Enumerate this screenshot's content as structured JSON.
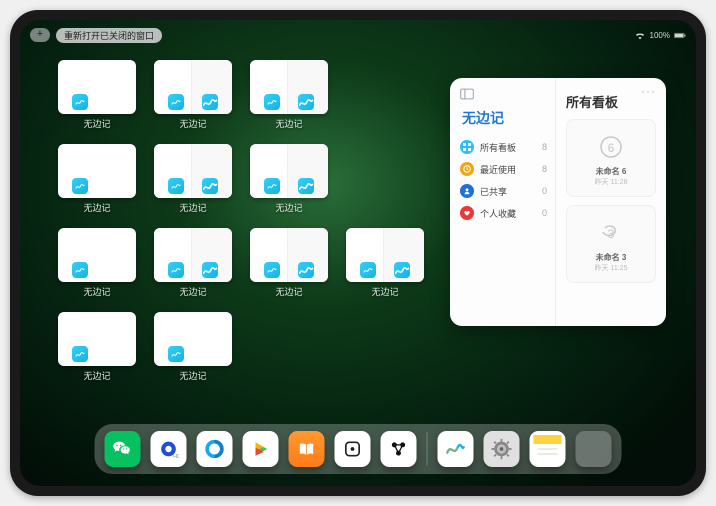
{
  "topbar": {
    "plus_label": "+",
    "reopen_label": "重新打开已关闭的窗口",
    "battery_pct": "100%"
  },
  "app_switcher": {
    "app_name": "无边记",
    "windows": [
      {
        "label": "无边记",
        "split": false
      },
      {
        "label": "无边记",
        "split": true
      },
      {
        "label": "无边记",
        "split": true
      },
      {
        "label": "无边记",
        "split": false
      },
      {
        "label": "无边记",
        "split": true
      },
      {
        "label": "无边记",
        "split": true
      },
      {
        "label": "无边记",
        "split": false
      },
      {
        "label": "无边记",
        "split": true
      },
      {
        "label": "无边记",
        "split": true
      },
      {
        "label": "无边记",
        "split": false
      },
      {
        "label": "无边记",
        "split": false
      },
      {
        "label": "无边记",
        "split": true
      }
    ]
  },
  "stage_panel": {
    "more_label": "···",
    "left_title": "无边记",
    "items": [
      {
        "icon": "grid",
        "color": "#25c3f2",
        "label": "所有看板",
        "count": "8"
      },
      {
        "icon": "clock",
        "color": "#f0a516",
        "label": "最近使用",
        "count": "8"
      },
      {
        "icon": "people",
        "color": "#1e6fe0",
        "label": "已共享",
        "count": "0"
      },
      {
        "icon": "heart",
        "color": "#f03535",
        "label": "个人收藏",
        "count": "0"
      }
    ],
    "right_title": "所有看板",
    "boards": [
      {
        "sketch_label": "6",
        "name": "未命名 6",
        "date": "昨天 11:28"
      },
      {
        "sketch_label": "3",
        "name": "未命名 3",
        "date": "昨天 11:25"
      }
    ]
  },
  "dock": {
    "apps_left": [
      {
        "name": "wechat",
        "bg": "#07c160"
      },
      {
        "name": "ucbrowser",
        "bg": "#ffffff"
      },
      {
        "name": "qqbrowser",
        "bg": "#ffffff"
      },
      {
        "name": "tencent-video",
        "bg": "#ffffff"
      },
      {
        "name": "books",
        "bg": "#ff9a2e"
      },
      {
        "name": "dice",
        "bg": "#ffffff"
      },
      {
        "name": "obsidian",
        "bg": "#ffffff"
      }
    ],
    "apps_right": [
      {
        "name": "freeform",
        "bg": "#ffffff"
      },
      {
        "name": "settings",
        "bg": "#e0e0e0"
      },
      {
        "name": "notes",
        "bg": "#ffffff"
      },
      {
        "name": "app-library",
        "bg": "folder"
      }
    ]
  },
  "colors": {
    "accent": "#1f78d1"
  }
}
